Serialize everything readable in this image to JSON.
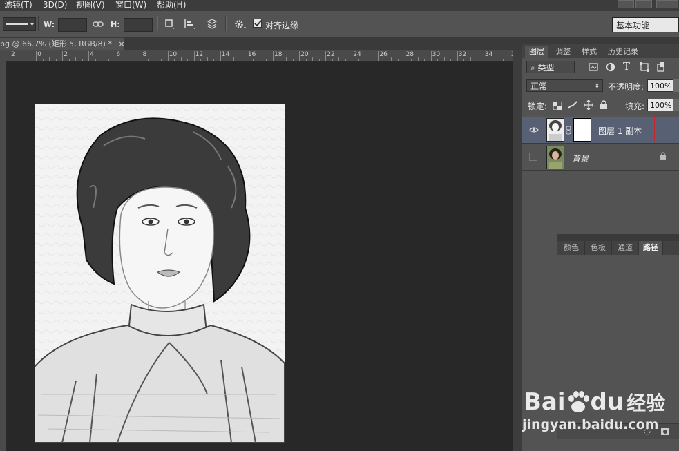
{
  "menubar": {
    "items": [
      "滤镜(T)",
      "3D(D)",
      "视图(V)",
      "窗口(W)",
      "帮助(H)"
    ]
  },
  "options": {
    "w_label": "W:",
    "h_label": "H:",
    "align_edges_label": "对齐边缘",
    "align_edges_checked": true,
    "workspace": "基本功能"
  },
  "document": {
    "tab_title": "pg @ 66.7% (矩形 5, RGB/8) *",
    "close_symbol": "×"
  },
  "ruler": {
    "labels": [
      "2",
      "0",
      "2",
      "4",
      "6",
      "8",
      "10",
      "12",
      "14",
      "16",
      "18",
      "20",
      "22",
      "24",
      "26",
      "28",
      "30",
      "32",
      "34",
      "3"
    ]
  },
  "layers_panel": {
    "tabs": [
      "图层",
      "调整",
      "样式",
      "历史记录"
    ],
    "active_tab": "图层",
    "filter_kind": "类型",
    "blend_mode": "正常",
    "opacity_label": "不透明度:",
    "opacity_value": "100%",
    "lock_label": "锁定:",
    "fill_label": "填充:",
    "fill_value": "100%",
    "layers": [
      {
        "name": "图层 1 副本",
        "visible": true,
        "selected": true
      },
      {
        "name": "背景",
        "visible": false,
        "locked": true
      }
    ],
    "selection_highlight_color": "#c9232b"
  },
  "lower_panel": {
    "tabs": [
      "颜色",
      "色板",
      "通道",
      "路径"
    ],
    "active_tab": "路径"
  },
  "watermark": {
    "brand": "Bai",
    "brand_suffix": "du",
    "cn_text": "经验",
    "url": "jingyan.baidu.com"
  }
}
